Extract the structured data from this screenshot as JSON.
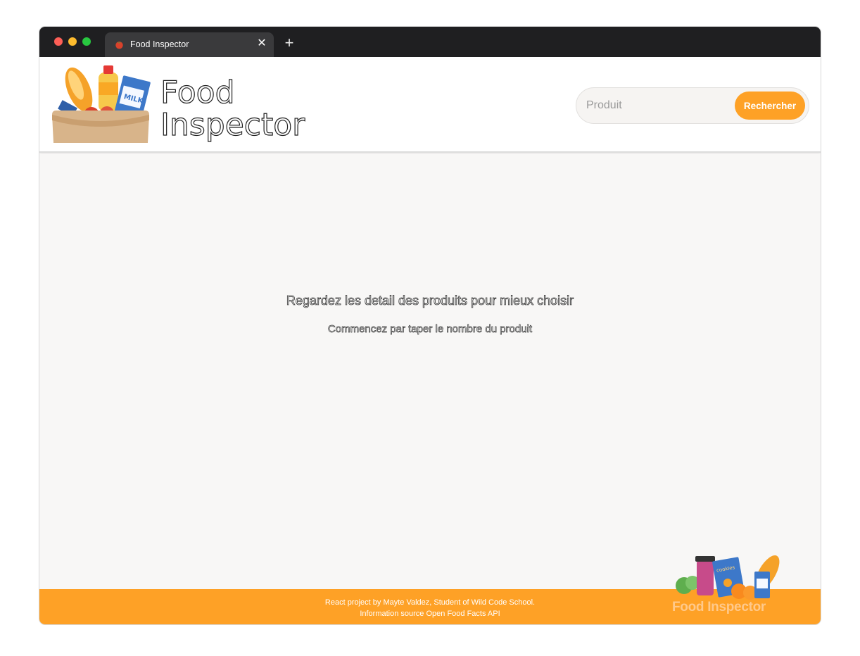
{
  "window": {
    "tab_title": "Food Inspector",
    "tab_close": "✕",
    "new_tab": "+"
  },
  "header": {
    "brand_line1": "Food",
    "brand_line2": "Inspector",
    "logo_icon": "grocery-bag-icon",
    "search": {
      "placeholder": "Produit",
      "value": "",
      "button_label": "Rechercher"
    }
  },
  "main": {
    "headline": "Regardez les detail des produits pour mieux choisir",
    "subline": "Commencez par taper le nombre du produit"
  },
  "footer": {
    "line1": "React project by Mayte Valdez, Student of Wild Code School.",
    "line2": "Information source Open Food Facts API",
    "brand": "Food Inspector",
    "art_icon": "groceries-icon"
  },
  "colors": {
    "accent": "#fea126",
    "titlebar": "#1f1f21",
    "tab": "#3a3a3c",
    "background": "#f8f7f6"
  }
}
